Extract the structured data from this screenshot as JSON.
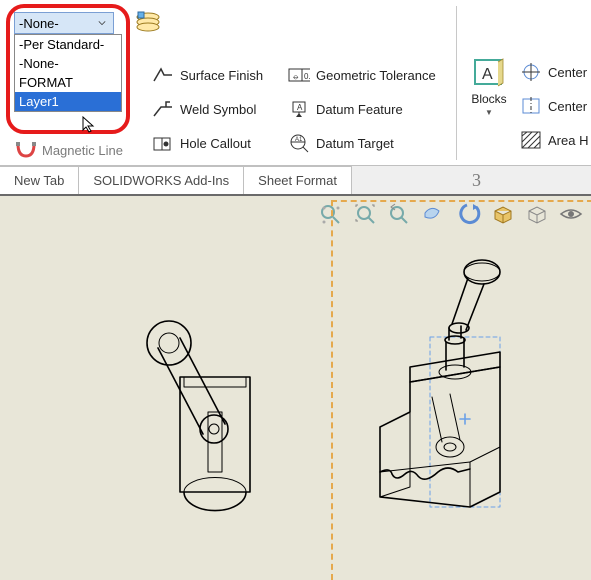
{
  "layer_selector": {
    "selected": "-None-",
    "options": [
      "-Per Standard-",
      "-None-",
      "FORMAT",
      "Layer1"
    ],
    "highlighted_index": 3
  },
  "ribbon": {
    "col2": [
      {
        "label": "Surface Finish",
        "icon": "surface-finish-icon"
      },
      {
        "label": "Weld Symbol",
        "icon": "weld-symbol-icon"
      },
      {
        "label": "Hole Callout",
        "icon": "hole-callout-icon"
      }
    ],
    "col3": [
      {
        "label": "Geometric Tolerance",
        "icon": "geometric-tolerance-icon"
      },
      {
        "label": "Datum Feature",
        "icon": "datum-feature-icon"
      },
      {
        "label": "Datum Target",
        "icon": "datum-target-icon"
      }
    ],
    "blocks_label": "Blocks",
    "right": [
      {
        "label": "Center",
        "icon": "center-mark-icon"
      },
      {
        "label": "Center",
        "icon": "centerline-icon"
      },
      {
        "label": "Area H",
        "icon": "area-hatch-icon"
      }
    ],
    "magnetic_line": "Magnetic Line"
  },
  "tabs": [
    "New Tab",
    "SOLIDWORKS Add-Ins",
    "Sheet Format"
  ],
  "sheet_zone": "3"
}
